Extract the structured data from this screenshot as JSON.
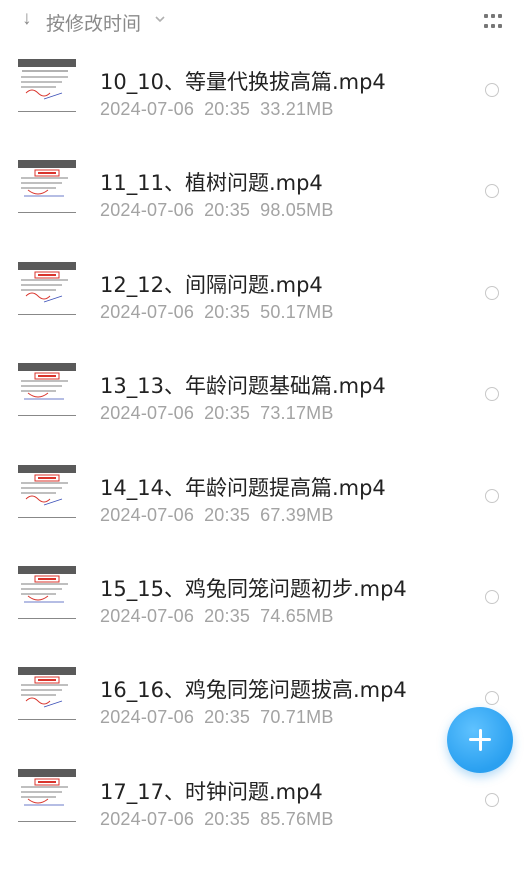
{
  "sort": {
    "arrow": "↓",
    "label": "按修改时间",
    "dropdown_icon": "chevron-down-icon"
  },
  "view_toggle": {
    "icon": "grid-view-icon"
  },
  "files": [
    {
      "name": "10_10、等量代换拔高篇.mp4",
      "date": "2024-07-06",
      "time": "20:35",
      "size": "33.21MB"
    },
    {
      "name": "11_11、植树问题.mp4",
      "date": "2024-07-06",
      "time": "20:35",
      "size": "98.05MB"
    },
    {
      "name": "12_12、间隔问题.mp4",
      "date": "2024-07-06",
      "time": "20:35",
      "size": "50.17MB"
    },
    {
      "name": "13_13、年龄问题基础篇.mp4",
      "date": "2024-07-06",
      "time": "20:35",
      "size": "73.17MB"
    },
    {
      "name": "14_14、年龄问题提高篇.mp4",
      "date": "2024-07-06",
      "time": "20:35",
      "size": "67.39MB"
    },
    {
      "name": "15_15、鸡兔同笼问题初步.mp4",
      "date": "2024-07-06",
      "time": "20:35",
      "size": "74.65MB"
    },
    {
      "name": "16_16、鸡兔同笼问题拔高.mp4",
      "date": "2024-07-06",
      "time": "20:35",
      "size": "70.71MB"
    },
    {
      "name": "17_17、时钟问题.mp4",
      "date": "2024-07-06",
      "time": "20:35",
      "size": "85.76MB"
    }
  ],
  "fab": {
    "icon": "plus-icon"
  },
  "colors": {
    "accent": "#2aa0f0",
    "primary_text": "#222222",
    "secondary_text": "#a3a3a3",
    "annotation_red": "#d9332b",
    "annotation_blue": "#3a4fb8"
  }
}
